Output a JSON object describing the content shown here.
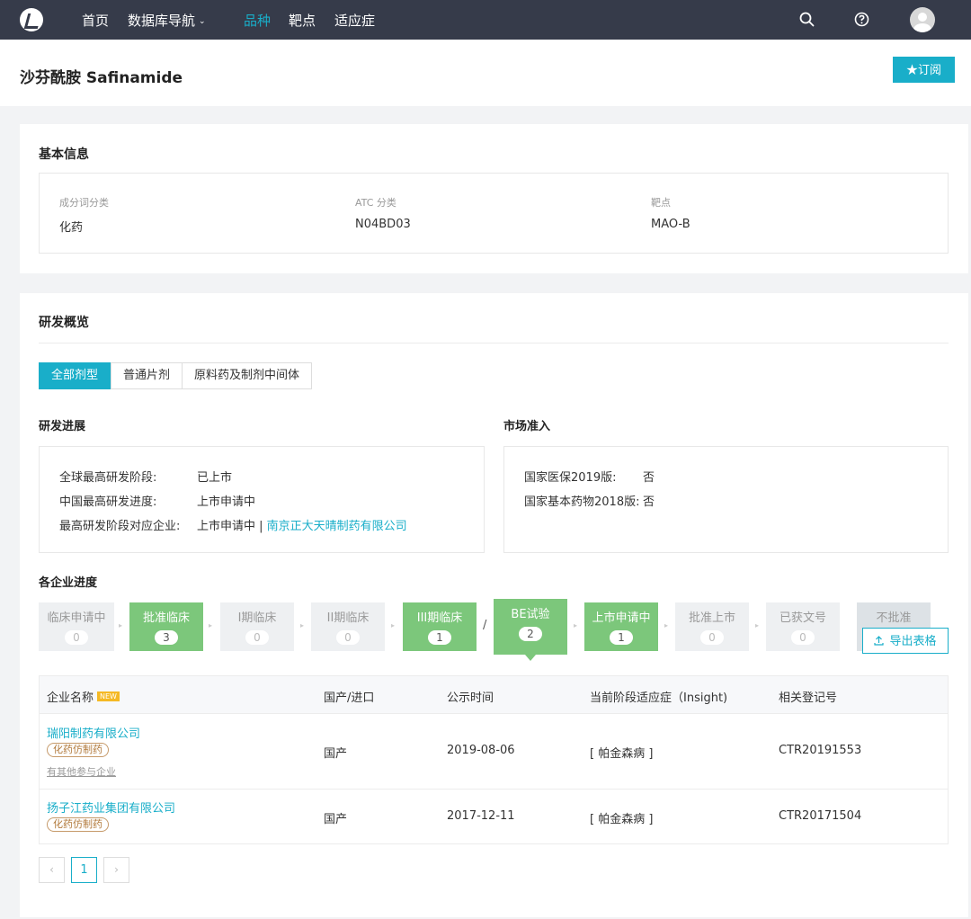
{
  "nav": {
    "items": [
      "首页",
      "数据库导航",
      "品种",
      "靶点",
      "适应症"
    ],
    "dropdown_caret": "⌄",
    "accent": "#19aec9"
  },
  "title": "沙芬酰胺 Safinamide",
  "subscribe_label": "★订阅",
  "basic": {
    "heading": "基本信息",
    "fields": [
      {
        "label": "成分词分类",
        "value": "化药"
      },
      {
        "label": "ATC 分类",
        "value": "N04BD03"
      },
      {
        "label": "靶点",
        "value": "MAO-B"
      }
    ]
  },
  "overview": {
    "heading": "研发概览",
    "tabs": [
      "全部剂型",
      "普通片剂",
      "原料药及制剂中间体"
    ],
    "progress": {
      "heading": "研发进展",
      "rows": [
        {
          "label": "全球最高研发阶段:",
          "value": "已上市"
        },
        {
          "label": "中国最高研发进度:",
          "value": "上市申请中"
        },
        {
          "label": "最高研发阶段对应企业:",
          "value": "上市申请中 | ",
          "link": "南京正大天晴制药有限公司"
        }
      ]
    },
    "market": {
      "heading": "市场准入",
      "rows": [
        {
          "label": "国家医保2019版:",
          "value": "否"
        },
        {
          "label": "国家基本药物2018版:",
          "value": "否"
        }
      ]
    },
    "company_progress": {
      "heading": "各企业进度",
      "stages": [
        {
          "name": "临床申请中",
          "count": "0"
        },
        {
          "name": "批准临床",
          "count": "3"
        },
        {
          "name": "I期临床",
          "count": "0"
        },
        {
          "name": "II期临床",
          "count": "0"
        },
        {
          "name": "III期临床",
          "count": "1"
        },
        {
          "name": "BE试验",
          "count": "2"
        },
        {
          "name": "上市申请中",
          "count": "1"
        },
        {
          "name": "批准上市",
          "count": "0"
        },
        {
          "name": "已获文号",
          "count": "0"
        },
        {
          "name": "不批准",
          "count": ""
        }
      ],
      "slash": "/",
      "arrow": "▸",
      "export_label": "导出表格"
    },
    "table": {
      "headers": [
        "企业名称",
        "国产/进口",
        "公示时间",
        "当前阶段适应症（Insight)",
        "相关登记号"
      ],
      "new_badge": "NEW",
      "rows": [
        {
          "company": "瑞阳制药有限公司",
          "tag": "化药仿制药",
          "note": "有其他参与企业",
          "origin": "国产",
          "date": "2019-08-06",
          "indication": "[ 帕金森病 ]",
          "reg": "CTR20191553"
        },
        {
          "company": "扬子江药业集团有限公司",
          "tag": "化药仿制药",
          "note": "",
          "origin": "国产",
          "date": "2017-12-11",
          "indication": "[ 帕金森病 ]",
          "reg": "CTR20171504"
        }
      ]
    },
    "pagination": {
      "prev": "‹",
      "current": "1",
      "next": "›"
    }
  }
}
